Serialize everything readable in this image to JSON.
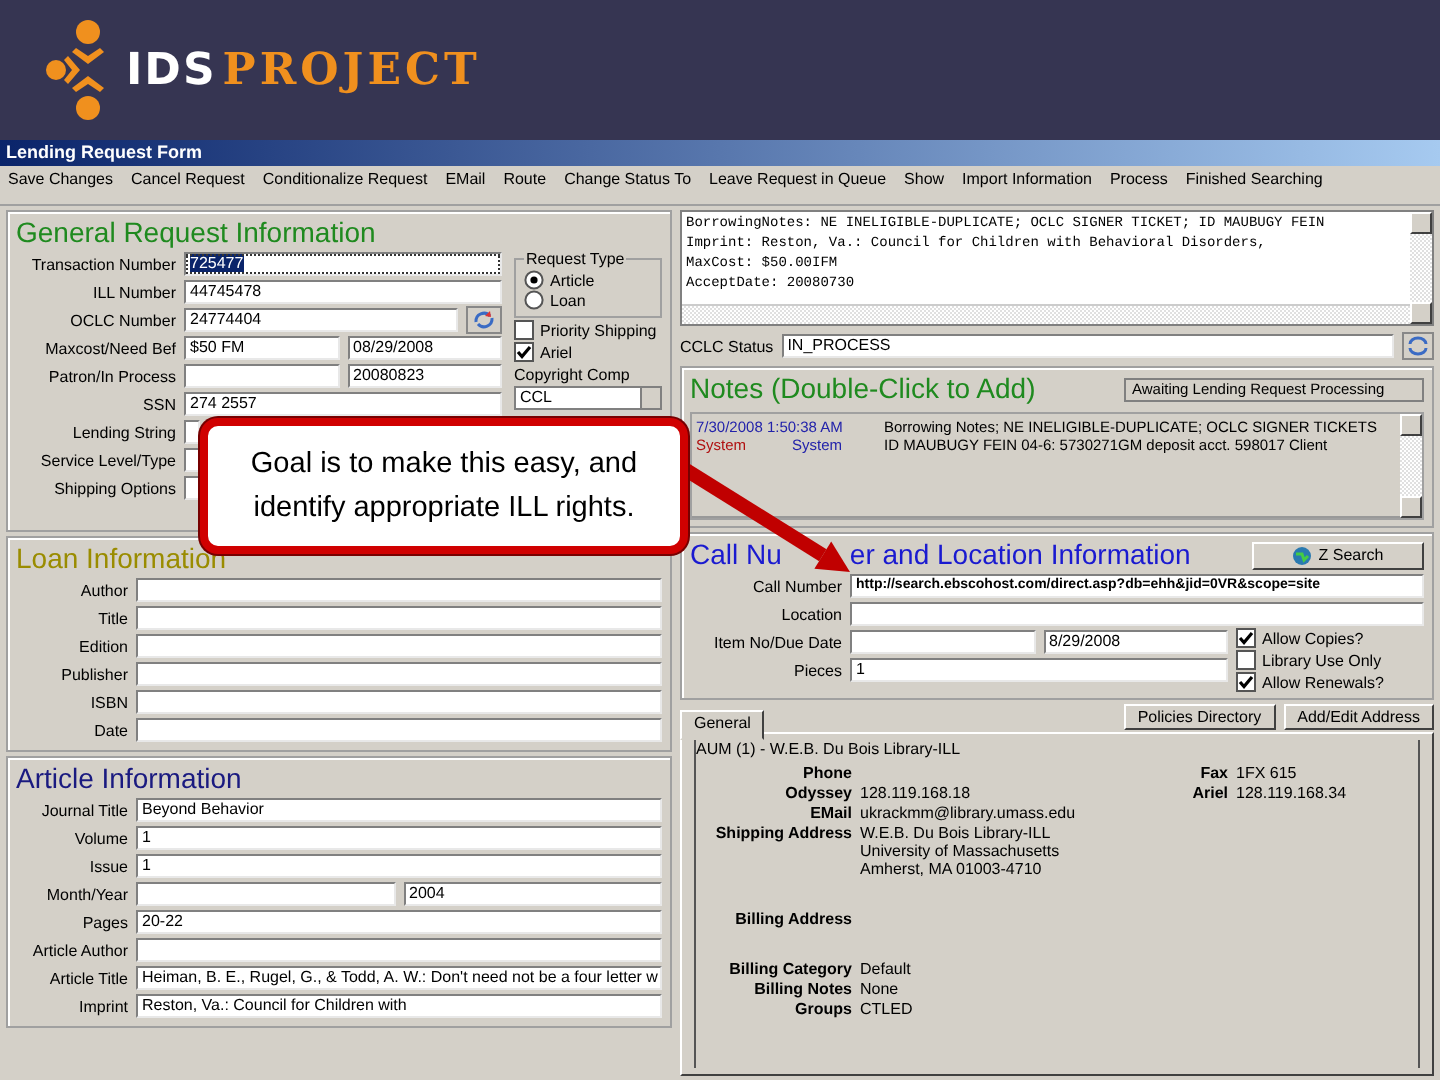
{
  "header": {
    "logo": {
      "first": "IDS",
      "second": "PROJECT"
    }
  },
  "window": {
    "title": "Lending Request Form"
  },
  "menu": [
    "Save Changes",
    "Cancel Request",
    "Conditionalize Request",
    "EMail",
    "Route",
    "Change Status To",
    "Leave Request in Queue",
    "Show",
    "Import Information",
    "Process",
    "Finished Searching"
  ],
  "general": {
    "title": "General Request Information",
    "fields": [
      {
        "label": "Transaction Number",
        "kind": "text",
        "value": "725477",
        "selected": true
      },
      {
        "label": "ILL Number",
        "kind": "text",
        "value": "44745478",
        "selected": false
      },
      {
        "label": "OCLC Number",
        "kind": "lookup",
        "value": "24774404",
        "selected": false
      },
      {
        "label": "Maxcost/Need Bef",
        "kind": "pair",
        "value": "$50 FM",
        "value2": "08/29/2008",
        "selected": false
      },
      {
        "label": "Patron/In Process",
        "kind": "pair",
        "value2": "20080823",
        "selected": false
      },
      {
        "label": "SSN",
        "kind": "text",
        "value": "274 2557",
        "selected": false
      },
      {
        "label": "Lending String",
        "kind": "covered",
        "selected": false
      },
      {
        "label": "Service Level/Type",
        "kind": "covered",
        "selected": false
      },
      {
        "label": "Shipping Options",
        "kind": "covered",
        "selected": false
      }
    ],
    "request_type": {
      "title": "Request Type",
      "options": [
        {
          "label": "Article",
          "selected": true
        },
        {
          "label": "Loan",
          "selected": false
        }
      ]
    },
    "checks": [
      {
        "label": "Priority Shipping",
        "checked": false
      },
      {
        "label": "Ariel",
        "checked": true
      }
    ],
    "copyright": {
      "label": "Copyright Comp",
      "value": "CCL"
    }
  },
  "loan": {
    "title": "Loan Information",
    "fields": [
      {
        "label": "Author",
        "kind": "text"
      },
      {
        "label": "Title",
        "kind": "text"
      },
      {
        "label": "Edition",
        "kind": "text"
      },
      {
        "label": "Publisher",
        "kind": "text"
      },
      {
        "label": "ISBN",
        "kind": "text"
      },
      {
        "label": "Date",
        "kind": "text"
      }
    ]
  },
  "article": {
    "title": "Article Information",
    "fields": [
      {
        "label": "Journal Title",
        "kind": "text",
        "value": "Beyond Behavior"
      },
      {
        "label": "Volume",
        "kind": "text",
        "value": "1"
      },
      {
        "label": "Issue",
        "kind": "text",
        "value": "1"
      },
      {
        "label": "Month/Year",
        "kind": "pair",
        "value2": "2004"
      },
      {
        "label": "Pages",
        "kind": "text",
        "value": "20-22"
      },
      {
        "label": "Article Author",
        "kind": "text"
      },
      {
        "label": "Article Title",
        "kind": "text",
        "value": "Heiman, B. E., Rugel, G., & Todd, A. W.: Don't need not be a four letter w"
      },
      {
        "label": "Imprint",
        "kind": "text",
        "value": "Reston, Va.: Council for Children with"
      }
    ]
  },
  "borrowing_notes": {
    "lines": [
      "BorrowingNotes: NE INELIGIBLE-DUPLICATE; OCLC SIGNER TICKET; ID MAUBUGY FEIN",
      "Imprint: Reston, Va.: Council for Children with Behavioral Disorders,",
      "MaxCost: $50.00IFM",
      "AcceptDate: 20080730"
    ]
  },
  "cclc": {
    "label": "CCLC Status",
    "value": "IN_PROCESS"
  },
  "notes": {
    "title": "Notes (Double-Click to Add)",
    "status": "Awaiting Lending Request Processing",
    "entries": [
      {
        "date": "7/30/2008 1:50:38 AM",
        "source": "System",
        "user": "System",
        "text": "Borrowing Notes; NE INELIGIBLE-DUPLICATE; OCLC SIGNER TICKETS ID MAUBUGY FEIN 04-6: 5730271GM deposit acct. 598017 Client"
      }
    ]
  },
  "call": {
    "title_parts": [
      "Call Nu",
      "er and Location Information"
    ],
    "search_button": "Z Search",
    "fields": [
      {
        "label": "Call Number",
        "kind": "text",
        "value": "http://search.ebscohost.com/direct.asp?db=ehh&jid=0VR&scope=site"
      },
      {
        "label": "Location",
        "kind": "text"
      }
    ],
    "item_fields": [
      {
        "label": "Item No/Due Date",
        "kind": "pair",
        "value2": "8/29/2008"
      },
      {
        "label": "Pieces",
        "kind": "text",
        "value": "1"
      }
    ],
    "checks": [
      {
        "label": "Allow Copies?",
        "checked": true
      },
      {
        "label": "Library Use Only",
        "checked": false
      },
      {
        "label": "Allow Renewals?",
        "checked": true
      }
    ]
  },
  "tabs": [
    {
      "label": "General",
      "selected": true
    }
  ],
  "buttons": [
    "Policies Directory",
    "Add/Edit Address"
  ],
  "address": {
    "heading": "AUM (1) - W.E.B. Du Bois Library-ILL",
    "groups": [
      [
        {
          "label": "Phone",
          "extra": {
            "label": "Fax",
            "value": "1FX 615"
          }
        },
        {
          "label": "Odyssey",
          "value": [
            "128.119.168.18"
          ],
          "extra": {
            "label": "Ariel",
            "value": "128.119.168.34"
          }
        },
        {
          "label": "EMail",
          "value": [
            "ukrackmm@library.umass.edu"
          ]
        },
        {
          "label": "Shipping Address",
          "value": [
            "W.E.B. Du Bois Library-ILL",
            "University of Massachusetts",
            "Amherst, MA 01003-4710"
          ]
        }
      ],
      [
        {
          "label": "Billing Address"
        }
      ],
      [
        {
          "label": "Billing Category",
          "value": [
            "Default"
          ]
        },
        {
          "label": "Billing Notes",
          "value": [
            "None"
          ]
        },
        {
          "label": "Groups",
          "value": [
            "CTLED"
          ]
        }
      ]
    ]
  },
  "callout": {
    "text": "Goal is to make this easy, and identify appropriate ILL rights."
  }
}
